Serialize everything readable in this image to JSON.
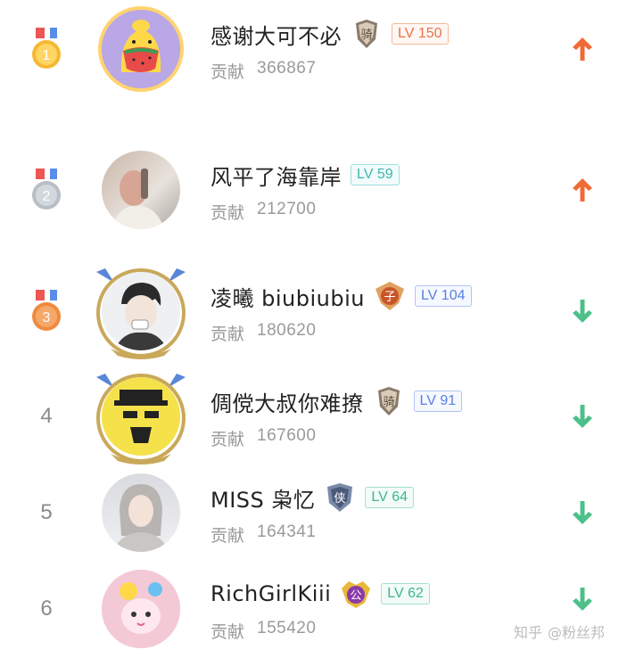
{
  "contributors_label": "贡献",
  "ranking": [
    {
      "rank": "1",
      "medal": "gold",
      "name": "感谢大可不必",
      "role_badge": "骑",
      "badge_icon": "knight-badge-icon",
      "level": "LV 150",
      "level_color": "orange",
      "contribution": "366867",
      "trend": "up"
    },
    {
      "rank": "2",
      "medal": "silver",
      "name": "风平了海靠岸",
      "role_badge": "",
      "badge_icon": "",
      "level": "LV 59",
      "level_color": "teal",
      "contribution": "212700",
      "trend": "up"
    },
    {
      "rank": "3",
      "medal": "bronze",
      "name": "凌曦 biubiubiu",
      "role_badge": "子",
      "badge_icon": "prince-badge-icon",
      "level": "LV 104",
      "level_color": "blue",
      "contribution": "180620",
      "trend": "down"
    },
    {
      "rank": "4",
      "medal": "",
      "name": "倜傥大叔你难撩",
      "role_badge": "骑",
      "badge_icon": "knight-badge-icon",
      "level": "LV 91",
      "level_color": "blue",
      "contribution": "167600",
      "trend": "down"
    },
    {
      "rank": "5",
      "medal": "",
      "name": "MISS 枭忆",
      "role_badge": "侠",
      "badge_icon": "hero-badge-icon",
      "level": "LV 64",
      "level_color": "green",
      "contribution": "164341",
      "trend": "down"
    },
    {
      "rank": "6",
      "medal": "",
      "name": "RichGirlKiii",
      "role_badge": "公",
      "badge_icon": "duke-badge-icon",
      "level": "LV 62",
      "level_color": "green",
      "contribution": "155420",
      "trend": "down"
    }
  ],
  "colors": {
    "up": "#f06a35",
    "down": "#4dbf8a",
    "gold": "#f6b832",
    "silver": "#b8bec6",
    "bronze": "#f08a3d"
  },
  "watermark": {
    "site": "知乎",
    "handle": "@粉丝邦"
  }
}
